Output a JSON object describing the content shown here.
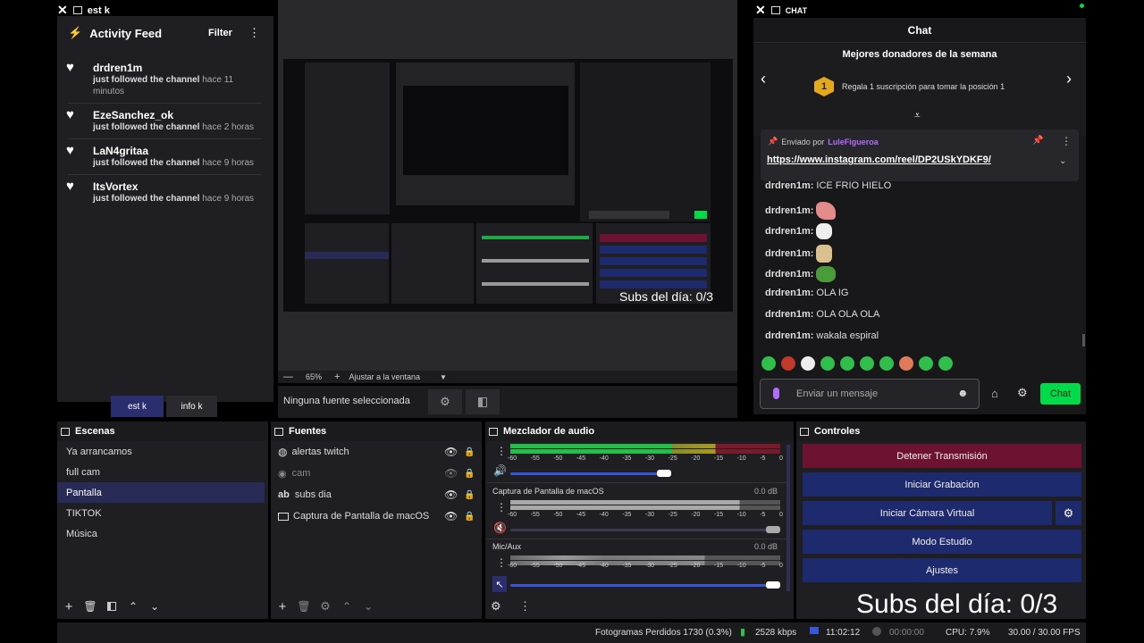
{
  "activity_dock": {
    "window_title": "est k",
    "title": "Activity Feed",
    "filter_label": "Filter",
    "items": [
      {
        "name": "drdren1m",
        "action": "just followed the channel",
        "time": "hace 11 minutos"
      },
      {
        "name": "EzeSanchez_ok",
        "action": "just followed the channel",
        "time": "hace 2 horas"
      },
      {
        "name": "LaN4gritaa",
        "action": "just followed the channel",
        "time": "hace 9 horas"
      },
      {
        "name": "ItsVortex",
        "action": "just followed the channel",
        "time": "hace 9 horas"
      }
    ],
    "tabs": [
      "est k",
      "info k"
    ]
  },
  "preview": {
    "overlay_text": "Subs del día: 0/3",
    "zoom": "65%",
    "fit_label": "Ajustar a la ventana",
    "no_source_text": "Ninguna fuente seleccionada"
  },
  "chat_dock": {
    "window_title": "CHAT",
    "title": "Chat",
    "donors_title": "Mejores donadores de la semana",
    "donor_rank": "1",
    "donor_text": "Regala 1 suscripción para tomar la posición 1",
    "pinned_by_label": "Enviado por",
    "pinned_user": "LuleFigueroa",
    "pinned_link": "https://www.instagram.com/reel/DP2USkYDKF9/",
    "messages": [
      {
        "user": "drdren1m:",
        "text": "ICE FRIO HIELO"
      },
      {
        "user": "drdren1m:",
        "text": ""
      },
      {
        "user": "drdren1m:",
        "text": ""
      },
      {
        "user": "drdren1m:",
        "text": ""
      },
      {
        "user": "drdren1m:",
        "text": ""
      },
      {
        "user": "drdren1m:",
        "text": "OLA IG"
      },
      {
        "user": "drdren1m:",
        "text": "OLA OLA OLA"
      },
      {
        "user": "drdren1m:",
        "text": "wakala espiral"
      }
    ],
    "input_placeholder": "Enviar un mensaje",
    "send_label": "Chat"
  },
  "scenes": {
    "title": "Escenas",
    "items": [
      "Ya arrancamos",
      "full cam",
      "Pantalla",
      "TIKTOK",
      "Música"
    ],
    "selected": "Pantalla"
  },
  "sources": {
    "title": "Fuentes",
    "items": [
      {
        "name": "alertas twitch",
        "icon": "globe-icon"
      },
      {
        "name": "cam",
        "icon": "camera-icon"
      },
      {
        "name": "subs dia",
        "icon": "text-icon"
      },
      {
        "name": "Captura de Pantalla de macOS",
        "icon": "monitor-icon"
      }
    ]
  },
  "mixer": {
    "title": "Mezclador de audio",
    "ticks": [
      "-60",
      "-55",
      "-50",
      "-45",
      "-40",
      "-35",
      "-30",
      "-25",
      "-20",
      "-15",
      "-10",
      "-5",
      "0"
    ],
    "channels": [
      {
        "name": "",
        "db": ""
      },
      {
        "name": "Captura de Pantalla de macOS",
        "db": "0.0 dB"
      },
      {
        "name": "Mic/Aux",
        "db": "0.0 dB"
      }
    ]
  },
  "controls": {
    "title": "Controles",
    "buttons": [
      "Detener Transmisión",
      "Iniciar Grabación",
      "Iniciar Cámara Virtual",
      "Modo Estudio",
      "Ajustes"
    ]
  },
  "overlay_bottom": "Subs del día: 0/3",
  "status": {
    "dropped": "Fotogramas Perdidos 1730 (0.3%)",
    "bitrate": "2528 kbps",
    "stream_time": "11:02:12",
    "rec_time": "00:00:00",
    "cpu": "CPU: 7.9%",
    "fps": "30.00 / 30.00 FPS"
  },
  "colors": {
    "accent_green": "#00db4a",
    "stop_red": "#6d1230",
    "button_blue": "#1e2a6e",
    "chat_purple": "#b46cff"
  }
}
